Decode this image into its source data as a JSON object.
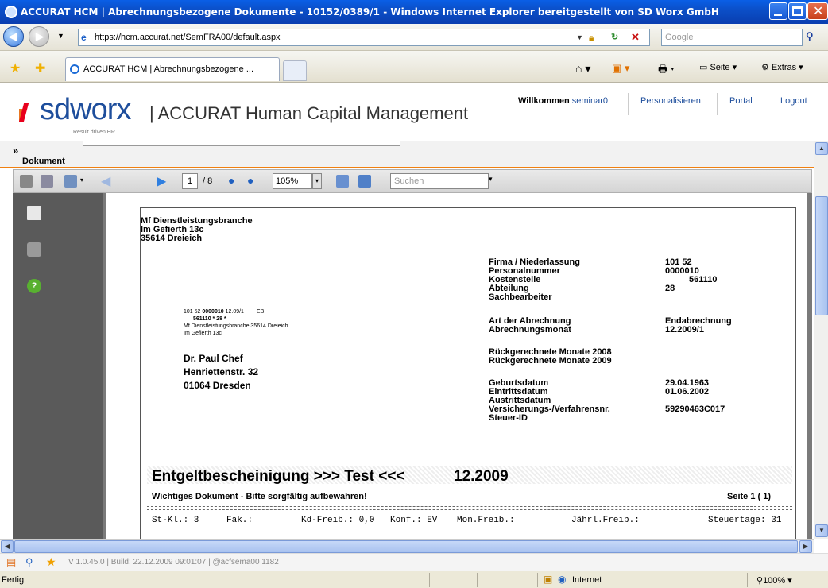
{
  "window": {
    "title": "ACCURAT HCM | Abrechnungsbezogene Dokumente - 10152/0389/1 - Windows Internet Explorer bereitgestellt von SD Worx GmbH"
  },
  "browser": {
    "url": "https://hcm.accurat.net/SemFRA00/default.aspx",
    "search_placeholder": "Google",
    "tab_label": "ACCURAT HCM | Abrechnungsbezogene ...",
    "seite_label": "Seite",
    "extras_label": "Extras"
  },
  "header": {
    "logo_text": "sdworx",
    "logo_tagline": "Result driven HR",
    "app_title": "| ACCURAT Human Capital Management",
    "welcome_label": "Willkommen",
    "user": "seminar0",
    "links": [
      "Personalisieren",
      "Portal",
      "Logout"
    ]
  },
  "panel": {
    "expand": "»",
    "title": "Dokument"
  },
  "report_toolbar": {
    "page": "1",
    "page_of": "/ 8",
    "zoom": "105%",
    "search_placeholder": "Suchen"
  },
  "document": {
    "sender": [
      "Mf Dienstleistungsbranche",
      "Im Gefierth 13c",
      "35614 Dreieich"
    ],
    "info_labels": [
      "Firma / Niederlassung",
      "Personalnummer",
      "Kostenstelle",
      "Abteilung",
      "Sachbearbeiter",
      "Art der Abrechnung",
      "Abrechnungsmonat",
      "Rückgerechnete Monate 2008",
      "Rückgerechnete Monate 2009",
      "Geburtsdatum",
      "Eintrittsdatum",
      "Austrittsdatum",
      "Versicherungs-/Verfahrensnr.",
      "Steuer-ID"
    ],
    "info_values": {
      "firma": "101 52",
      "personalnummer": "0000010",
      "kostenstelle": "561110",
      "abteilung": "28",
      "art": "Endabrechnung",
      "monat": "12.2009/1",
      "geburtsdatum": "29.04.1963",
      "eintrittsdatum": "01.06.2002",
      "versicherungsnr": "59290463C017"
    },
    "small_lines": {
      "l1a": "101 52",
      "l1b": "0000010",
      "l1c": "12.09/1",
      "l1d": "EB",
      "l2": "561110 * 28   *",
      "l3": "Mf Dienstleistungsbranche  35614  Dreieich",
      "l4": "Im Gefierth 13c"
    },
    "recipient": [
      "Dr. Paul Chef",
      "Henriettenstr. 32",
      "01064 Dresden"
    ],
    "banner_title": "Entgeltbescheinigung >>> Test <<<",
    "banner_month": "12.2009",
    "notice": "Wichtiges Dokument - Bitte sorgfältig aufbewahren!",
    "page_indicator": "Seite  1 ( 1)",
    "tax_row": {
      "stkl": "St-Kl.: 3",
      "fak": "Fak.:",
      "kdfreib": "Kd-Freib.: 0,0",
      "konf": "Konf.: EV",
      "monfreib": "Mon.Freib.:",
      "jahrlfreib": "Jährl.Freib.:",
      "steuertage": "Steuertage: 31"
    }
  },
  "footer": {
    "version": "V 1.0.45.0 | Build: 22.12.2009 09:01:07 | @acfsema00 1182"
  },
  "statusbar": {
    "left": "Fertig",
    "zone": "Internet",
    "zoom": "100%"
  }
}
